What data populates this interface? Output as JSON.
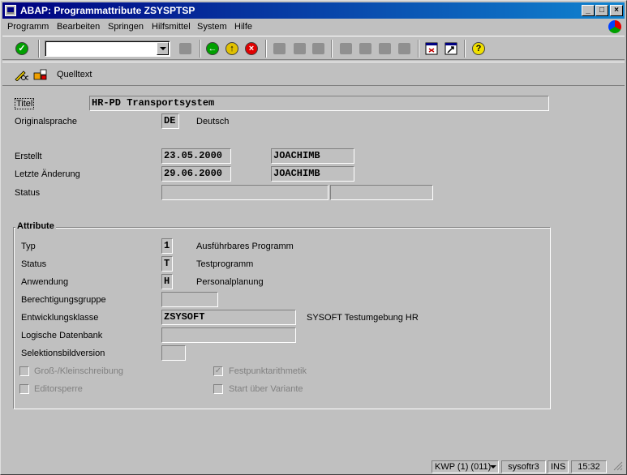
{
  "window": {
    "title": "ABAP: Programmattribute ZSYSPTSP"
  },
  "menu": [
    {
      "label": "Programm"
    },
    {
      "label": "Bearbeiten"
    },
    {
      "label": "Springen"
    },
    {
      "label": "Hilfsmittel"
    },
    {
      "label": "System"
    },
    {
      "label": "Hilfe"
    }
  ],
  "command_field": {
    "value": ""
  },
  "app_toolbar": {
    "source_button_label": "Quelltext"
  },
  "form": {
    "titel": {
      "label": "Titel",
      "value": "HR-PD Transportsystem"
    },
    "originalsprache": {
      "label": "Originalsprache",
      "code": "DE",
      "text": "Deutsch"
    },
    "erstellt": {
      "label": "Erstellt",
      "date": "23.05.2000",
      "user": "JOACHIMB"
    },
    "letzte_aenderung": {
      "label": "Letzte Änderung",
      "date": "29.06.2000",
      "user": "JOACHIMB"
    },
    "status": {
      "label": "Status",
      "value1": "",
      "value2": ""
    }
  },
  "attribute": {
    "group_title": "Attribute",
    "typ": {
      "label": "Typ",
      "code": "1",
      "text": "Ausführbares Programm"
    },
    "status": {
      "label": "Status",
      "code": "T",
      "text": "Testprogramm"
    },
    "anwendung": {
      "label": "Anwendung",
      "code": "H",
      "text": "Personalplanung"
    },
    "berechtigungsgruppe": {
      "label": "Berechtigungsgruppe",
      "value": ""
    },
    "entwicklungsklasse": {
      "label": "Entwicklungsklasse",
      "value": "ZSYSOFT",
      "text": "SYSOFT Testumgebung HR"
    },
    "logische_datenbank": {
      "label": "Logische Datenbank",
      "value": ""
    },
    "selektionsbildversion": {
      "label": "Selektionsbildversion",
      "value": ""
    },
    "gross_klein": {
      "label": "Groß-/Kleinschreibung",
      "checked": false
    },
    "festpunkt": {
      "label": "Festpunktarithmetik",
      "checked": true
    },
    "editorsperre": {
      "label": "Editorsperre",
      "checked": false
    },
    "start_variante": {
      "label": "Start über Variante",
      "checked": false
    }
  },
  "statusbar": {
    "system": "KWP (1) (011)",
    "server": "sysoftr3",
    "mode": "INS",
    "time": "15:32"
  },
  "colors": {
    "title_bar": "#000080",
    "window_bg": "#c0c0c0"
  }
}
